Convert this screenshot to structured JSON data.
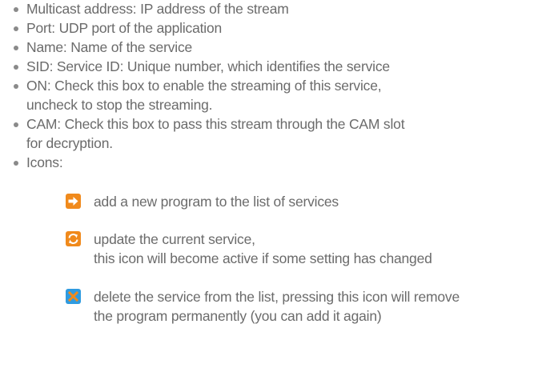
{
  "bullets": [
    {
      "text": "Multicast address: IP address of the stream"
    },
    {
      "text": "Port: UDP port of the application"
    },
    {
      "text": "Name: Name of the service"
    },
    {
      "text": "SID: Service ID: Unique number, which identifies the service"
    },
    {
      "text": "ON: Check this box to enable the streaming of this service,\nuncheck to stop the streaming."
    },
    {
      "text": "CAM: Check this box to pass this stream through the CAM slot\nfor decryption."
    },
    {
      "text": "Icons:"
    }
  ],
  "icons": [
    {
      "icon": "add-arrow-icon",
      "color": "#f08a1c",
      "text": "add a new program to the list of services"
    },
    {
      "icon": "refresh-icon",
      "color": "#f08a1c",
      "text": "update the current service,\nthis icon will become active if some setting has changed"
    },
    {
      "icon": "delete-x-icon",
      "color": "#2f9be0",
      "text": "delete the service from the list, pressing this icon will remove\nthe program permanently (you can add it again)"
    }
  ]
}
